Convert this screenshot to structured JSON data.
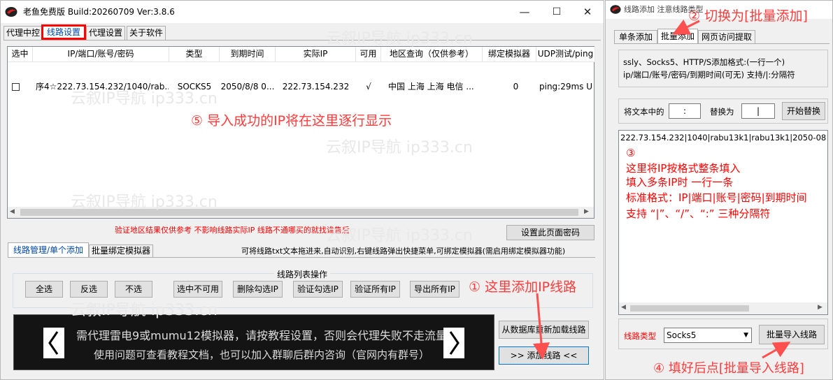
{
  "main": {
    "title": "老鱼免费版 Build:20260709 Ver:3.8.6",
    "tabs": [
      "代理中控",
      "线路设置",
      "代理设置",
      "关于软件"
    ],
    "columns": [
      "选中",
      "IP/端口/账号/密码",
      "类型",
      "到期时间",
      "实际IP",
      "可用",
      "地区查询（仅供参考）",
      "绑定模拟器",
      "UDP测试/ping"
    ],
    "row": {
      "ip": "序4☆222.73.154.232/1040/rab...",
      "type": "SOCKS5",
      "expire": "2050/8/8 0...",
      "real_ip": "222.73.154.232",
      "ok": "√",
      "region": "中国 上海 上海 电信 ...",
      "emulator": "0",
      "udp": "ping:29ms  U"
    },
    "notice": "验证地区结果仅供参考 不影响线路实际IP 线路不通哪买的就找谁售后",
    "set_password_btn": "设置此页面密码",
    "subtabs": [
      "线路管理/单个添加",
      "批量绑定模拟器"
    ],
    "hint": "可将线路txt文本拖进来,自动识别,右键线路弹出快捷菜单,可绑定模拟器(需启用绑定模拟器功能)",
    "group_title": "线路列表操作",
    "ops": [
      "全选",
      "反选",
      "不选",
      "选中不可用",
      "删除勾选IP",
      "验证勾选IP",
      "验证所有IP",
      "导出所有IP"
    ],
    "banner_line1": "需代理雷电9或mumu12模拟器，请按教程设置，否则会代理失败不走流量",
    "banner_line2": "使用问题可查看教程文档，也可以加入群聊后群内咨询（官网内有群号）",
    "load_db_btn": "从数据库重新加载线路",
    "add_line_btn": ">>  添加线路  <<",
    "watermark": "云叙IP导航  ip333.cn"
  },
  "side": {
    "title": "线路添加 注意线路类型",
    "tabs": [
      "单条添加",
      "批量添加",
      "网页访问提取"
    ],
    "format_line1": "ssly、Socks5、HTTP/S添加格式:(一行一个)",
    "format_line2": "ip/端口/账号/密码/到期时间(可无) 支持/|:分隔符",
    "replace_label": "将文本中的",
    "replace_from": ":",
    "replace_with_label": "替换为",
    "replace_to": "|",
    "replace_btn": "开始替换",
    "textarea_line": "222.73.154.232|1040|rabu13k1|rabu13k1|2050-08",
    "textarea_notes": [
      "③",
      "这里将IP按格式整条填入",
      "填入多条IP时 一行一条",
      "标准格式：IP|端口|账号|密码|到期时间",
      "支持 “|”、“/”、“:” 三种分隔符"
    ],
    "type_label": "线路类型",
    "type_value": "Socks5",
    "import_btn": "批量导入线路"
  },
  "callouts": {
    "c1": "① 这里添加IP线路",
    "c2": "② 切换为[批量添加]",
    "c4": "④ 填好后点[批量导入线路]",
    "c5": "⑤ 导入成功的IP将在这里逐行显示"
  },
  "colors": {
    "accent": "#0078d7",
    "callout": "#ff3b3b",
    "notice": "#ff0000",
    "banner_bg": "#141414"
  }
}
